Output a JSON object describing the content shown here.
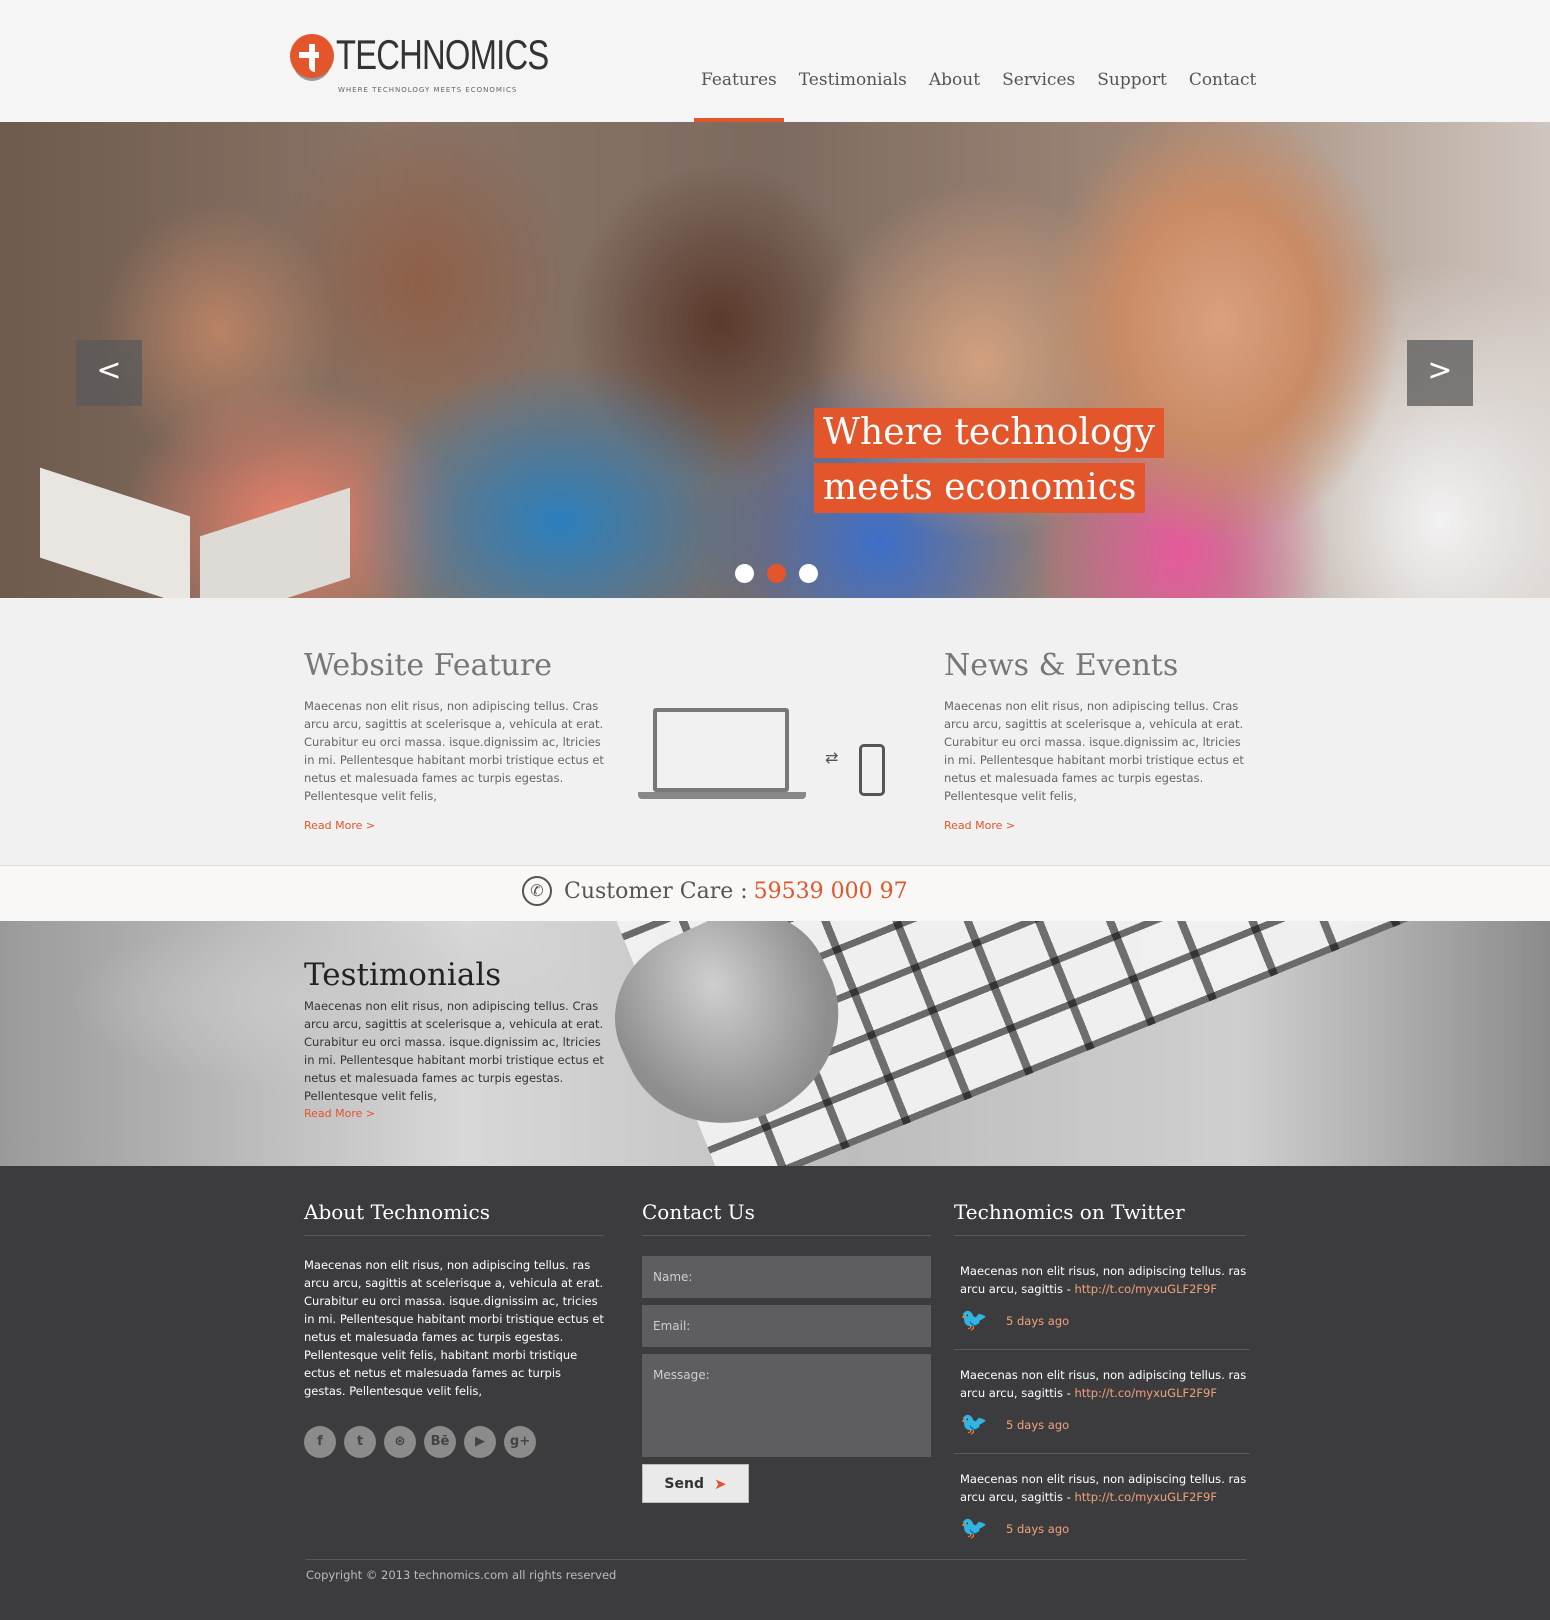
{
  "brand": {
    "name": "TECHNOMICS",
    "tagline": "WHERE TECHNOLOGY MEETS ECONOMICS"
  },
  "nav": {
    "items": [
      "Features",
      "Testimonials",
      "About",
      "Services",
      "Support",
      "Contact"
    ],
    "active": "Features"
  },
  "hero": {
    "caption_line1": "Where technology",
    "caption_line2": "meets economics",
    "prev_arrow": "<",
    "next_arrow": ">",
    "slide_count": 3,
    "active_slide": 2
  },
  "features": {
    "left": {
      "title": "Website Feature",
      "body": "Maecenas non elit risus, non adipiscing tellus. Cras arcu arcu, sagittis at scelerisque a, vehicula at erat. Curabitur eu orci massa. isque.dignissim ac, ltricies in mi. Pellentesque habitant morbi tristique ectus et netus et malesuada fames ac turpis egestas. Pellentesque velit felis,",
      "read_more": "Read More >"
    },
    "right": {
      "title": "News & Events",
      "body": "Maecenas non elit risus, non adipiscing tellus. Cras arcu arcu, sagittis at scelerisque a, vehicula at erat. Curabitur eu orci massa. isque.dignissim ac, ltricies in mi. Pellentesque habitant morbi tristique ectus et netus et malesuada fames ac turpis egestas. Pellentesque velit felis,",
      "read_more": "Read More >"
    },
    "swap_icon": "⇄"
  },
  "care": {
    "label": "Customer Care :",
    "number": "59539 000 97",
    "icon": "✆"
  },
  "testimonials": {
    "title": "Testimonials",
    "body": "Maecenas non elit risus, non adipiscing tellus. Cras arcu arcu, sagittis at scelerisque a, vehicula at erat. Curabitur eu orci massa. isque.dignissim ac, ltricies in mi. Pellentesque habitant morbi tristique ectus et netus et malesuada fames ac turpis egestas. Pellentesque velit felis,",
    "read_more": "Read More >"
  },
  "footer": {
    "about": {
      "title": "About Technomics",
      "body": "Maecenas non elit risus, non adipiscing tellus. ras arcu arcu, sagittis at scelerisque a, vehicula at erat. Curabitur eu orci massa. isque.dignissim ac, tricies in mi. Pellentesque habitant morbi tristique ectus et netus et malesuada fames ac turpis egestas. Pellentesque velit felis, habitant morbi tristique ectus et netus et malesuada fames ac turpis gestas. Pellentesque velit felis,",
      "social": [
        {
          "name": "facebook-icon",
          "glyph": "f"
        },
        {
          "name": "twitter-icon",
          "glyph": "t"
        },
        {
          "name": "dribbble-icon",
          "glyph": "⊛"
        },
        {
          "name": "behance-icon",
          "glyph": "Bē"
        },
        {
          "name": "youtube-icon",
          "glyph": "▶"
        },
        {
          "name": "google-plus-icon",
          "glyph": "g+"
        }
      ]
    },
    "contact": {
      "title": "Contact Us",
      "name_placeholder": "Name:",
      "email_placeholder": "Email:",
      "message_placeholder": "Message:",
      "send_label": "Send",
      "send_icon": "➤"
    },
    "twitter": {
      "title": "Technomics on Twitter",
      "bird_icon": "🐦",
      "tweets": [
        {
          "text": "Maecenas non elit risus, non adipiscing tellus. ras arcu arcu, sagittis - ",
          "link": "http://t.co/myxuGLF2F9F",
          "time": "5 days ago"
        },
        {
          "text": "Maecenas non elit risus, non adipiscing tellus. ras arcu arcu, sagittis - ",
          "link": "http://t.co/myxuGLF2F9F",
          "time": "5 days ago"
        },
        {
          "text": "Maecenas non elit risus, non adipiscing tellus. ras arcu arcu, sagittis - ",
          "link": "http://t.co/myxuGLF2F9F",
          "time": "5 days ago"
        }
      ]
    },
    "copyright": "Copyright © 2013 technomics.com all rights reserved"
  },
  "colors": {
    "accent": "#e3552b",
    "footer_bg": "#3c3c3e",
    "link_light": "#f0a27a"
  }
}
